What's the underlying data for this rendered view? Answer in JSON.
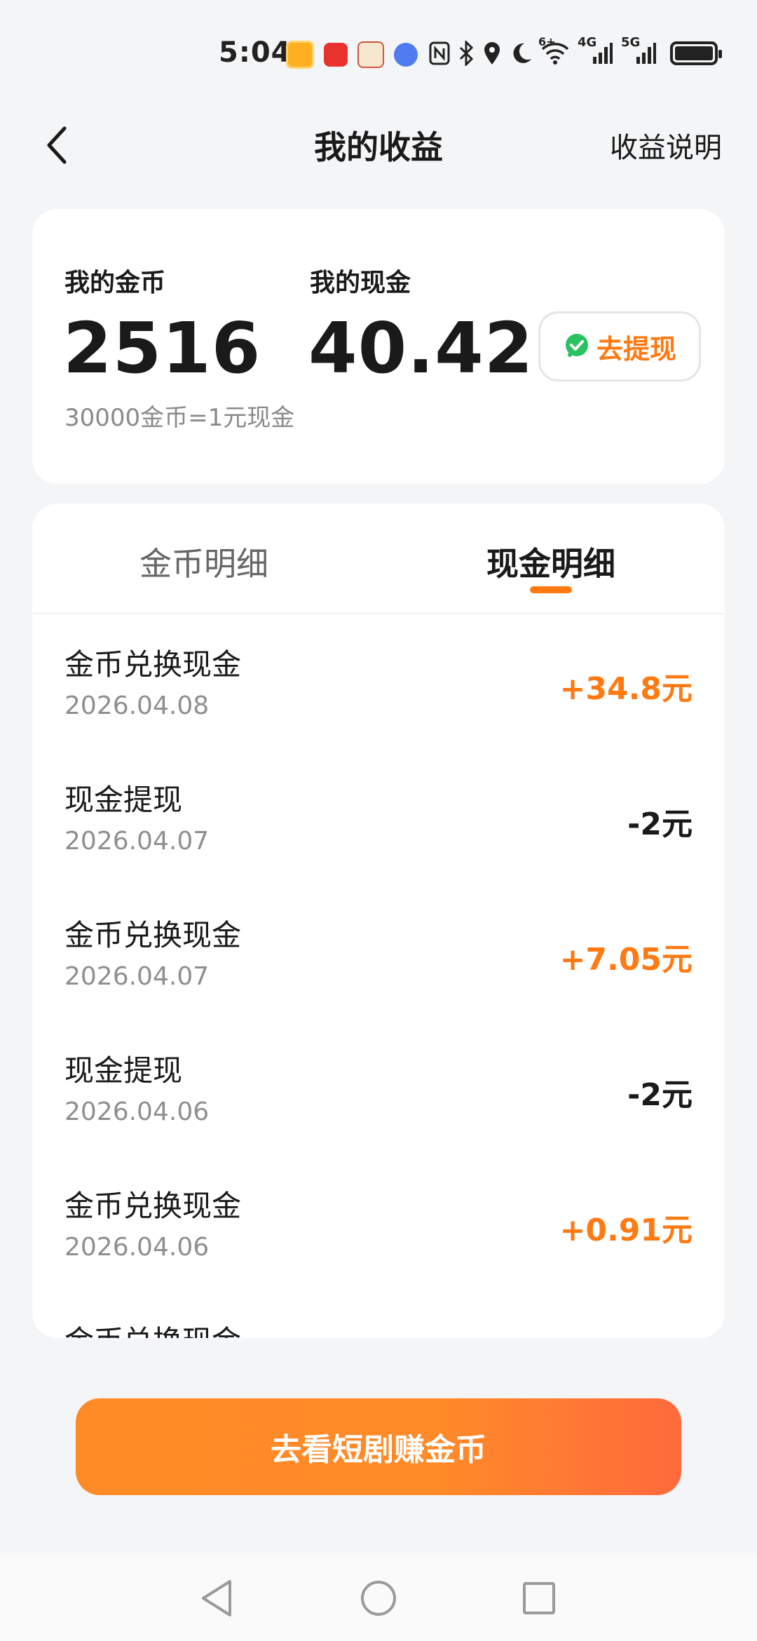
{
  "status_bar": {
    "time": "5:04",
    "app_icons": [
      "orange-app-icon",
      "red-app-icon",
      "cartoon-app-icon",
      "music-app-icon"
    ],
    "icons": [
      "nfc-icon",
      "bluetooth-icon",
      "location-icon",
      "moon-icon",
      "wifi-icon",
      "signal-4g-icon",
      "signal-5g-icon",
      "battery-icon"
    ],
    "network_4g": "4G",
    "network_5g": "5G",
    "wifi_label": "6+"
  },
  "header": {
    "title": "我的收益",
    "right_link": "收益说明"
  },
  "balance": {
    "coins_label": "我的金币",
    "coins_value": "2516",
    "cash_label": "我的现金",
    "cash_value": "40.42",
    "rate_note": "30000金币=1元现金",
    "withdraw_label": "去提现",
    "withdraw_icon": "wechat-icon",
    "colors": {
      "accent": "#ff7a12",
      "wechat": "#2ac161"
    }
  },
  "tabs": [
    {
      "label": "金币明细",
      "active": false
    },
    {
      "label": "现金明细",
      "active": true
    }
  ],
  "records": [
    {
      "title": "金币兑换现金",
      "date": "2026.04.08",
      "amount": "+34.8元",
      "type": "income"
    },
    {
      "title": "现金提现",
      "date": "2026.04.07",
      "amount": "-2元",
      "type": "expense"
    },
    {
      "title": "金币兑换现金",
      "date": "2026.04.07",
      "amount": "+7.05元",
      "type": "income"
    },
    {
      "title": "现金提现",
      "date": "2026.04.06",
      "amount": "-2元",
      "type": "expense"
    },
    {
      "title": "金币兑换现金",
      "date": "2026.04.06",
      "amount": "+0.91元",
      "type": "income"
    },
    {
      "title": "金币兑换现金",
      "date": "",
      "amount": "",
      "type": "income"
    }
  ],
  "cta": {
    "label": "去看短剧赚金币"
  },
  "nav_bar": {
    "icons": [
      "nav-back-icon",
      "nav-home-icon",
      "nav-recent-icon"
    ]
  }
}
